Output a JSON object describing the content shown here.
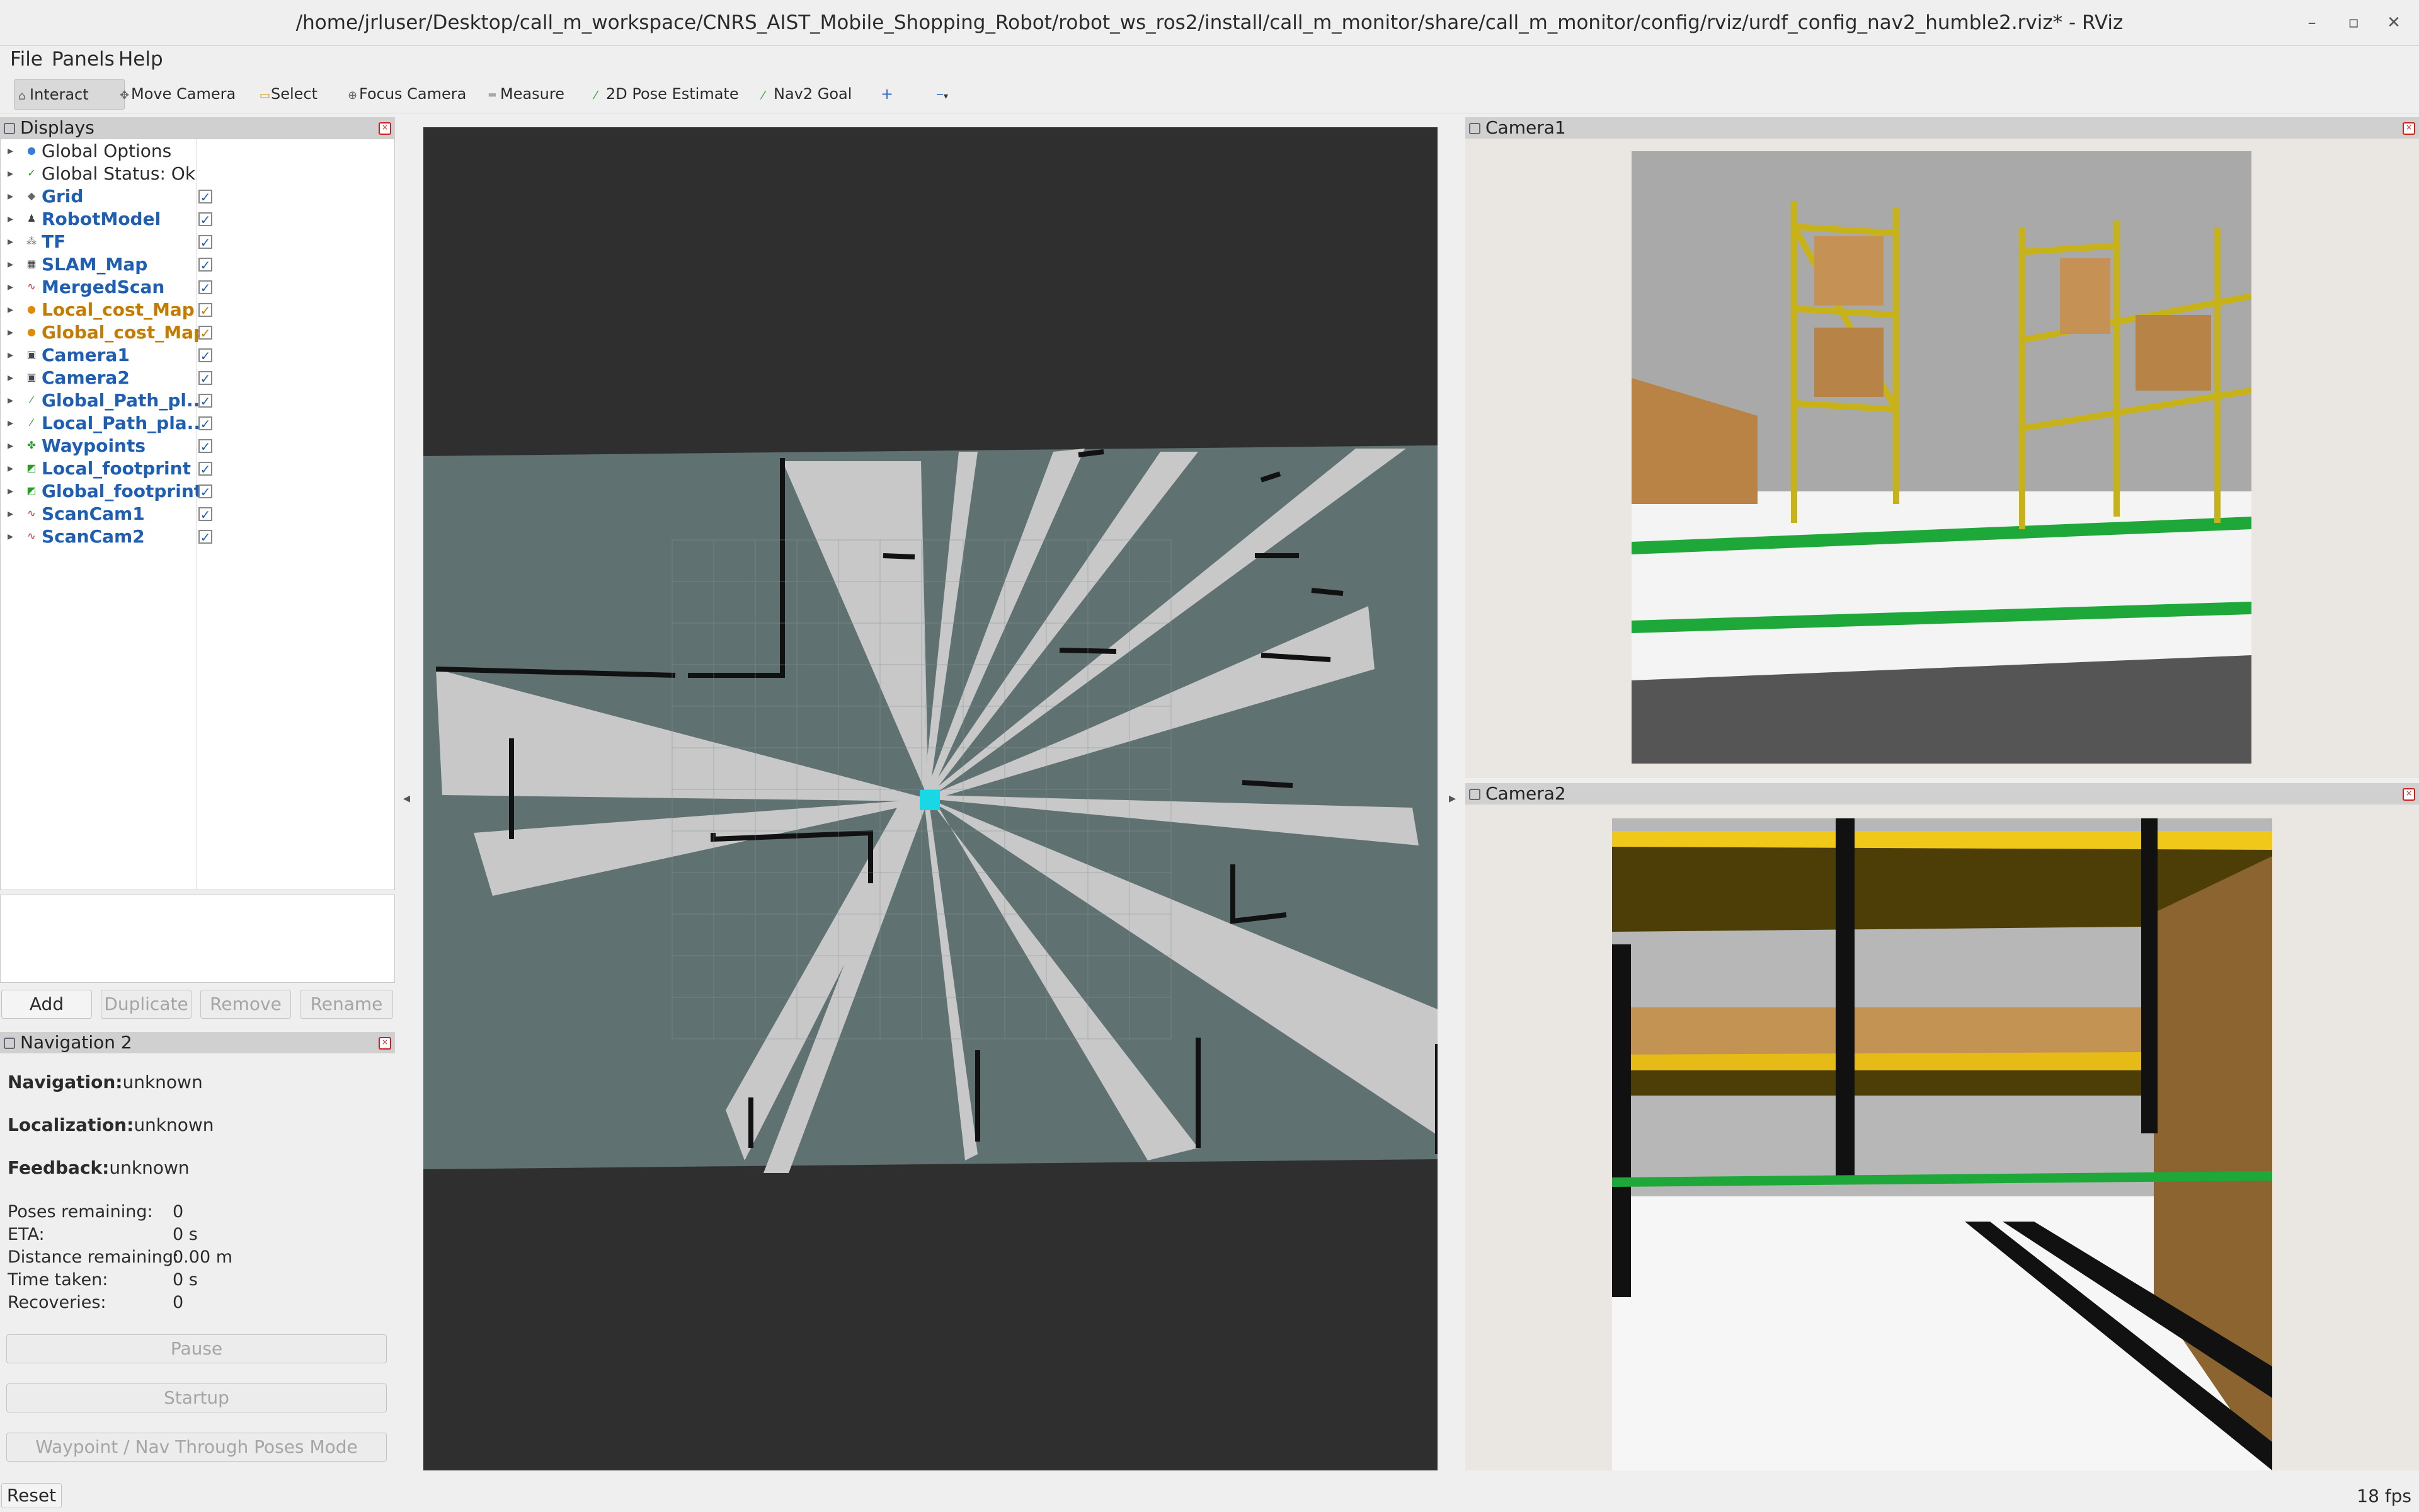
{
  "window": {
    "title": "/home/jrluser/Desktop/call_m_workspace/CNRS_AIST_Mobile_Shopping_Robot/robot_ws_ros2/install/call_m_monitor/share/call_m_monitor/config/rviz/urdf_config_nav2_humble2.rviz* - RViz"
  },
  "menu": {
    "file": "File",
    "panels": "Panels",
    "help": "Help"
  },
  "toolbar": {
    "interact": "Interact",
    "move_camera": "Move Camera",
    "select": "Select",
    "focus_camera": "Focus Camera",
    "measure": "Measure",
    "pose_estimate": "2D Pose Estimate",
    "nav2_goal": "Nav2 Goal"
  },
  "displays": {
    "title": "Displays",
    "items": [
      {
        "label": "Global Options",
        "style": "plain",
        "icon": "gear-icon",
        "checked": null
      },
      {
        "label": "Global Status: Ok",
        "style": "plain",
        "icon": "check-icon",
        "checked": null
      },
      {
        "label": "Grid",
        "style": "blue",
        "icon": "grid-icon",
        "checked": true
      },
      {
        "label": "RobotModel",
        "style": "blue",
        "icon": "robot-icon",
        "checked": true
      },
      {
        "label": "TF",
        "style": "blue",
        "icon": "tf-icon",
        "checked": true
      },
      {
        "label": "SLAM_Map",
        "style": "blue",
        "icon": "map-icon",
        "checked": true
      },
      {
        "label": "MergedScan",
        "style": "blue",
        "icon": "scan-icon",
        "checked": true
      },
      {
        "label": "Local_cost_Map",
        "style": "orange",
        "icon": "warning-icon",
        "checked": true
      },
      {
        "label": "Global_cost_Map",
        "style": "orange",
        "icon": "warning-icon",
        "checked": true
      },
      {
        "label": "Camera1",
        "style": "blue",
        "icon": "camera-icon",
        "checked": true
      },
      {
        "label": "Camera2",
        "style": "blue",
        "icon": "camera-icon",
        "checked": true
      },
      {
        "label": "Global_Path_pl...",
        "style": "blue",
        "icon": "path-icon",
        "checked": true
      },
      {
        "label": "Local_Path_pla...",
        "style": "blue",
        "icon": "path-icon",
        "checked": true
      },
      {
        "label": "Waypoints",
        "style": "blue",
        "icon": "marker-icon",
        "checked": true
      },
      {
        "label": "Local_footprint",
        "style": "blue",
        "icon": "polygon-icon",
        "checked": true
      },
      {
        "label": "Global_footprint",
        "style": "blue",
        "icon": "polygon-icon",
        "checked": true
      },
      {
        "label": "ScanCam1",
        "style": "blue",
        "icon": "scan-icon",
        "checked": true
      },
      {
        "label": "ScanCam2",
        "style": "blue",
        "icon": "scan-icon",
        "checked": true
      }
    ],
    "checkmark": "✓",
    "buttons": {
      "add": "Add",
      "duplicate": "Duplicate",
      "remove": "Remove",
      "rename": "Rename"
    }
  },
  "nav2": {
    "title": "Navigation 2",
    "navigation_label": "Navigation:",
    "navigation_value": "unknown",
    "localization_label": "Localization:",
    "localization_value": "unknown",
    "feedback_label": "Feedback:",
    "feedback_value": "unknown",
    "stats": [
      {
        "label": "Poses remaining:",
        "value": "0"
      },
      {
        "label": "ETA:",
        "value": "0 s"
      },
      {
        "label": "Distance remaining:",
        "value": "0.00 m"
      },
      {
        "label": "Time taken:",
        "value": "0 s"
      },
      {
        "label": "Recoveries:",
        "value": "0"
      }
    ],
    "pause": "Pause",
    "startup": "Startup",
    "waypoint_mode": "Waypoint / Nav Through Poses Mode"
  },
  "camera1": {
    "title": "Camera1"
  },
  "camera2": {
    "title": "Camera2"
  },
  "status": {
    "reset": "Reset",
    "fps": "18 fps"
  },
  "colors": {
    "map_unknown": "#5f7170",
    "map_free": "#c8c8c8",
    "map_occupied": "#111111",
    "robot": "#19d8e6",
    "label_blue": "#1e5fb4",
    "label_orange": "#c47c00"
  }
}
